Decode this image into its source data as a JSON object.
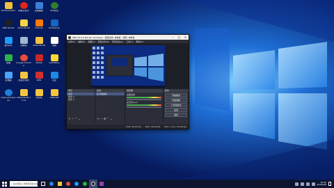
{
  "desktop": {
    "icons": [
      {
        "label": "Administrator",
        "color": "#f0c040",
        "round": false
      },
      {
        "label": "OBS Studio",
        "color": "#202020",
        "round": true
      },
      {
        "label": "腾讯QQ",
        "color": "#1e9bff",
        "round": false
      },
      {
        "label": "微信",
        "color": "#2bb24c",
        "round": false
      },
      {
        "label": "此电脑",
        "color": "#4aa3ff",
        "round": false
      },
      {
        "label": "Internet Explorer",
        "color": "#1e7fd8",
        "round": true
      },
      {
        "label": "网易云音乐",
        "color": "#e1251b",
        "round": true
      },
      {
        "label": "2020-06-08",
        "color": "#f5d547",
        "round": false
      },
      {
        "label": "回收站",
        "color": "#9fb7d6",
        "round": false
      },
      {
        "label": "Google Chrome",
        "color": "#e74c3c",
        "round": true
      },
      {
        "label": "新建文件夹",
        "color": "#f5c542",
        "round": false
      },
      {
        "label": "2020-06-08 17:31",
        "color": "#f5c542",
        "round": false
      },
      {
        "label": "控制面板",
        "color": "#3d7edb",
        "round": false
      },
      {
        "label": "Foxmail",
        "color": "#ff7a00",
        "round": false
      },
      {
        "label": "2020-06-08",
        "color": "#f5c542",
        "round": false
      },
      {
        "label": "Adobe",
        "color": "#c62828",
        "round": false
      },
      {
        "label": "WPS",
        "color": "#d32f2f",
        "round": false
      },
      {
        "label": "文件夹",
        "color": "#f5c542",
        "round": false
      },
      {
        "label": "360安全",
        "color": "#2e7d32",
        "round": true
      },
      {
        "label": "Photoshop",
        "color": "#1565c0",
        "round": false
      },
      {
        "label": "录屏",
        "color": "#fff",
        "round": false
      },
      {
        "label": "GoldWave",
        "color": "#fdd835",
        "round": false
      },
      {
        "label": "迅雷",
        "color": "#1e88e5",
        "round": false
      },
      {
        "label": "2020-06",
        "color": "#f5c542",
        "round": false
      }
    ]
  },
  "obs": {
    "title": "OBS 25.0.8 (64-bit, windows) - 配置文件: 未命名 - 场景: 未命名",
    "menu": [
      "文件(F)",
      "编辑(E)",
      "视图(V)",
      "配置文件(P)",
      "场景集合(S)",
      "工具(T)",
      "帮助(H)"
    ],
    "docks": {
      "scenes_title": "场景",
      "scenes": [
        "场景",
        "场景 2",
        "场景 3"
      ],
      "sources_title": "来源",
      "sources": [
        "显示器捕获"
      ],
      "mixer_title": "混音器",
      "mixer": [
        "桌面音频",
        "麦克风/Aux"
      ],
      "transitions_title": "场景过渡",
      "controls_title": "控件",
      "controls": [
        "开始推流",
        "开始录制",
        "工作室模式",
        "设置",
        "退出"
      ]
    },
    "status": {
      "live": "LIVE: 00:00:00",
      "rec": "REC: 00:00:00",
      "cpu": "CPU: 1.3%, 30.00 fps"
    }
  },
  "taskbar": {
    "search_placeholder": "在这里输入你要搜索的内容",
    "time": "16:46",
    "date": "2020/6/8"
  }
}
